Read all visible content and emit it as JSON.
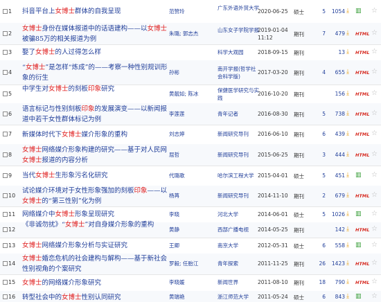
{
  "rows": [
    {
      "num": "1",
      "title": [
        {
          "t": "抖音平台上"
        },
        {
          "t": "女博士",
          "hl": true
        },
        {
          "t": "群体的自我呈现"
        }
      ],
      "author": "范赞玲",
      "source": "广东外语外贸大学",
      "date": "2020-06-25",
      "db": "硕士",
      "cited": "5",
      "downloads": "1054",
      "format_icon": "book-icon",
      "star": "☆"
    },
    {
      "num": "2",
      "title": [
        {
          "t": "女博士",
          "hl": true
        },
        {
          "t": "身份在媒体报道中的话语建构——以"
        },
        {
          "t": "女博士",
          "hl": true
        },
        {
          "t": "被骗85万的相关报道为例"
        }
      ],
      "author": "朱璐; 郭志杰",
      "source": "山东女子学院学报",
      "date": "2019-01-04 11:12",
      "db": "期刊",
      "cited": "7",
      "downloads": "479",
      "format_icon": "HTML",
      "star": "☆"
    },
    {
      "num": "3",
      "title": [
        {
          "t": "娶了"
        },
        {
          "t": "女博士",
          "hl": true
        },
        {
          "t": "的人过得怎么样"
        }
      ],
      "author": "",
      "source": "科学大观园",
      "date": "2018-09-15",
      "db": "期刊",
      "cited": "",
      "downloads": "13",
      "format_icon": "HTML",
      "star": "☆"
    },
    {
      "num": "4",
      "title": [
        {
          "t": "“"
        },
        {
          "t": "女博士",
          "hl": true
        },
        {
          "t": "”是怎样“炼成”的——考察一种性别规训形象的衍生"
        }
      ],
      "author": "孙彬",
      "source": "南开学报(哲学社会科学版)",
      "date": "2017-03-20",
      "db": "期刊",
      "cited": "4",
      "downloads": "655",
      "format_icon": "HTML",
      "star": "☆"
    },
    {
      "num": "5",
      "title": [
        {
          "t": "中学生对"
        },
        {
          "t": "女博士",
          "hl": true
        },
        {
          "t": "的刻板"
        },
        {
          "t": "印象",
          "hl": true
        },
        {
          "t": "研究"
        }
      ],
      "author": "黄靓如; 陈冰",
      "source": "保健医学研究与实践",
      "date": "2016-10-20",
      "db": "期刊",
      "cited": "",
      "downloads": "156",
      "format_icon": "HTML",
      "star": "☆"
    },
    {
      "num": "6",
      "title": [
        {
          "t": "语言标记与性别刻板"
        },
        {
          "t": "印象",
          "hl": true
        },
        {
          "t": "的发展演变——以新闻报道中若干女性群体标记为例"
        }
      ],
      "author": "李莲莲",
      "source": "青年记者",
      "date": "2016-08-30",
      "db": "期刊",
      "cited": "5",
      "downloads": "738",
      "format_icon": "HTML",
      "star": "☆"
    },
    {
      "num": "7",
      "title": [
        {
          "t": "新媒体时代下"
        },
        {
          "t": "女博士",
          "hl": true
        },
        {
          "t": "媒介形象的重构"
        }
      ],
      "author": "刘志婷",
      "source": "新闻研究导刊",
      "date": "2016-06-10",
      "db": "期刊",
      "cited": "6",
      "downloads": "439",
      "format_icon": "HTML",
      "star": "☆"
    },
    {
      "num": "8",
      "title": [
        {
          "t": "女博士",
          "hl": true
        },
        {
          "t": "网络媒介形象构建的研究——基于对人民网"
        },
        {
          "t": "女博士",
          "hl": true
        },
        {
          "t": "报道的内容分析"
        }
      ],
      "author": "屈哲",
      "source": "新闻研究导刊",
      "date": "2015-06-25",
      "db": "期刊",
      "cited": "3",
      "downloads": "444",
      "format_icon": "HTML",
      "star": "☆"
    },
    {
      "num": "9",
      "title": [
        {
          "t": "当代"
        },
        {
          "t": "女博士",
          "hl": true
        },
        {
          "t": "生形象污名化研究"
        }
      ],
      "author": "代璐歌",
      "source": "哈尔滨工程大学",
      "date": "2015-04-01",
      "db": "硕士",
      "cited": "5",
      "downloads": "451",
      "format_icon": "book-icon",
      "star": "☆"
    },
    {
      "num": "10",
      "title": [
        {
          "t": "试论媒介环境对于女性形象强加的刻板"
        },
        {
          "t": "印象",
          "hl": true
        },
        {
          "t": "——以"
        },
        {
          "t": "女博士",
          "hl": true
        },
        {
          "t": "的“第三性别”化为例"
        }
      ],
      "author": "杨苒",
      "source": "新闻研究导刊",
      "date": "2014-11-10",
      "db": "期刊",
      "cited": "2",
      "downloads": "679",
      "format_icon": "HTML",
      "star": "☆"
    },
    {
      "num": "11",
      "title": [
        {
          "t": "网络媒介中"
        },
        {
          "t": "女博士",
          "hl": true
        },
        {
          "t": "形象呈现研究"
        }
      ],
      "author": "李晓",
      "source": "河北大学",
      "date": "2014-06-01",
      "db": "硕士",
      "cited": "5",
      "downloads": "1026",
      "format_icon": "book-icon",
      "star": "☆"
    },
    {
      "num": "12",
      "title": [
        {
          "t": "《非诚勿扰》“"
        },
        {
          "t": "女博士",
          "hl": true
        },
        {
          "t": "”对自身媒介形象的重构"
        }
      ],
      "author": "黄静",
      "source": "西部广播电视",
      "date": "2014-05-25",
      "db": "期刊",
      "cited": "",
      "downloads": "142",
      "format_icon": "HTML",
      "star": "☆"
    },
    {
      "num": "13",
      "title": [
        {
          "t": "女博士",
          "hl": true
        },
        {
          "t": "网络媒介形象分析与实证研究"
        }
      ],
      "author": "王卿",
      "source": "南京大学",
      "date": "2012-05-31",
      "db": "硕士",
      "cited": "6",
      "downloads": "558",
      "format_icon": "book-icon",
      "star": "☆"
    },
    {
      "num": "14",
      "title": [
        {
          "t": "女博士",
          "hl": true
        },
        {
          "t": "婚恋危机的社会建构与解构——基于新社会性别视角的个案研究"
        }
      ],
      "author": "罗毅; 任胎江",
      "source": "青年探索",
      "date": "2011-11-25",
      "db": "期刊",
      "cited": "26",
      "downloads": "1423",
      "format_icon": "HTML",
      "star": "☆"
    },
    {
      "num": "15",
      "title": [
        {
          "t": "女博士",
          "hl": true
        },
        {
          "t": "的网络媒介形象研究"
        }
      ],
      "author": "李晓媛",
      "source": "新闻世界",
      "date": "2011-08-10",
      "db": "期刊",
      "cited": "18",
      "downloads": "790",
      "format_icon": "HTML",
      "star": "☆"
    },
    {
      "num": "16",
      "title": [
        {
          "t": "转型社会中的"
        },
        {
          "t": "女博士",
          "hl": true
        },
        {
          "t": "性别认同研究"
        }
      ],
      "author": "黄瑞艳",
      "source": "浙江师范大学",
      "date": "2011-05-24",
      "db": "硕士",
      "cited": "6",
      "downloads": "843",
      "format_icon": "book-icon",
      "star": "☆"
    }
  ]
}
